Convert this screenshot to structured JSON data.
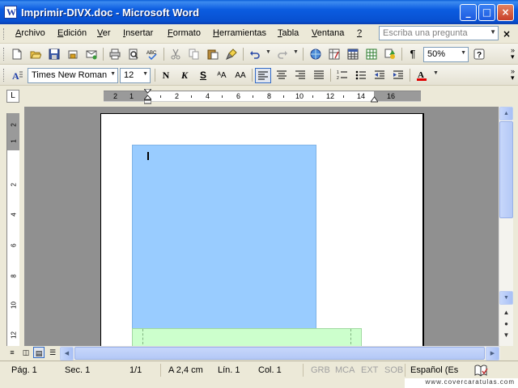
{
  "window": {
    "title": "Imprimir-DIVX.doc - Microsoft Word",
    "minimize_glyph": "_",
    "maximize_glyph": "□",
    "close_glyph": "×"
  },
  "menu": {
    "items": [
      {
        "name": "archivo",
        "first": "A",
        "rest": "rchivo"
      },
      {
        "name": "edicion",
        "first": "E",
        "rest": "dición"
      },
      {
        "name": "ver",
        "first": "V",
        "rest": "er"
      },
      {
        "name": "insertar",
        "first": "I",
        "rest": "nsertar"
      },
      {
        "name": "formato",
        "first": "F",
        "rest": "ormato"
      },
      {
        "name": "herramientas",
        "first": "H",
        "rest": "erramientas"
      },
      {
        "name": "tabla",
        "first": "T",
        "rest": "abla"
      },
      {
        "name": "ventana",
        "first": "V",
        "rest": "entana"
      },
      {
        "name": "ayuda",
        "first": "?",
        "rest": ""
      }
    ],
    "ask_placeholder": "Escriba una pregunta",
    "doc_close_glyph": "×"
  },
  "standard_toolbar": {
    "zoom": "50%"
  },
  "formatting_toolbar": {
    "font_name": "Times New Roman",
    "font_size": "12",
    "bold": "N",
    "italic": "K",
    "underline": "S",
    "char_scale": "ᴬA",
    "char_spacing": "AA"
  },
  "ruler": {
    "tab_glyph": "L",
    "h_numbers": [
      "2",
      "1",
      "2",
      "4",
      "6",
      "8",
      "10",
      "12",
      "14",
      "16"
    ],
    "v_numbers": [
      "2",
      "1",
      "2",
      "4",
      "6",
      "8",
      "10",
      "12"
    ]
  },
  "status": {
    "page": "Pág.  1",
    "section": "Sec.  1",
    "pages": "1/1",
    "at": "A  2,4 cm",
    "line": "Lín.  1",
    "column": "Col.  1",
    "grb": "GRB",
    "mca": "MCA",
    "ext": "EXT",
    "sob": "SOB",
    "language": "Español (Es"
  },
  "watermark": "www.covercaratulas.com",
  "colors": {
    "title_blue": "#0b5ce0",
    "blue_frame": "#99ccff",
    "green_frame": "#ccffcc",
    "workspace": "#909090"
  }
}
